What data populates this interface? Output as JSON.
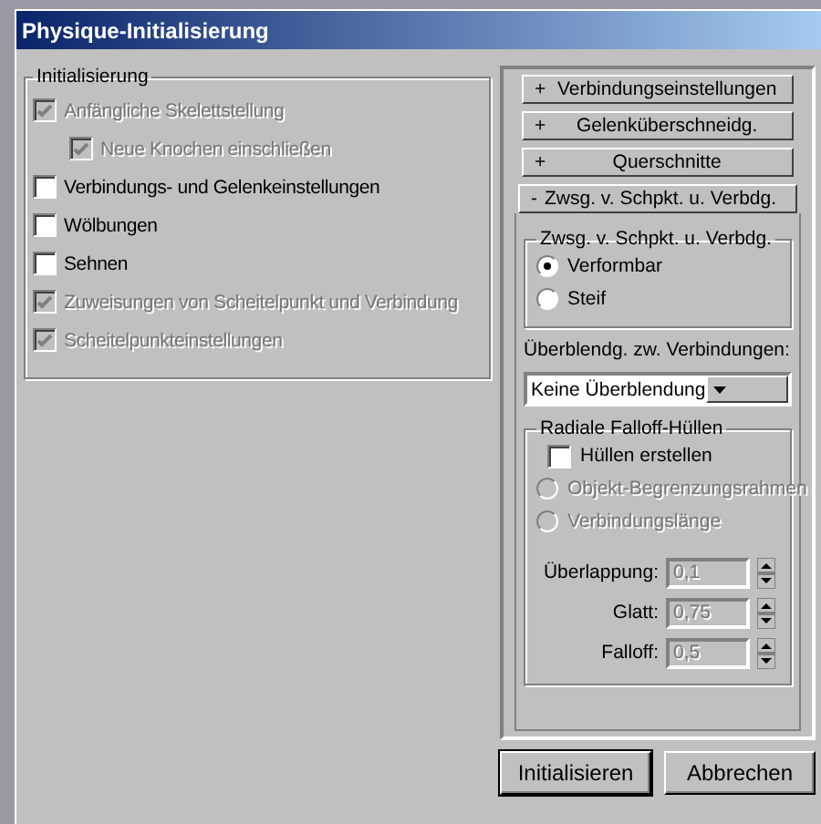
{
  "window": {
    "title": "Physique-Initialisierung"
  },
  "init_group": {
    "title": "Initialisierung",
    "options": [
      {
        "label": "Anfängliche Skelettstellung",
        "checked": true,
        "disabled": true,
        "children": [
          {
            "label": "Neue Knochen einschließen",
            "checked": true,
            "disabled": true
          }
        ]
      },
      {
        "label": "Verbindungs- und Gelenkeinstellungen",
        "checked": false,
        "disabled": false
      },
      {
        "label": "Wölbungen",
        "checked": false,
        "disabled": false
      },
      {
        "label": "Sehnen",
        "checked": false,
        "disabled": false
      },
      {
        "label": "Zuweisungen von Scheitelpunkt und Verbindung",
        "checked": true,
        "disabled": true
      },
      {
        "label": "Scheitelpunkteinstellungen",
        "checked": true,
        "disabled": true
      }
    ]
  },
  "rollouts": [
    {
      "sign": "+",
      "label": "Verbindungseinstellungen",
      "expanded": false
    },
    {
      "sign": "+",
      "label": "Gelenküberschneidg.",
      "expanded": false
    },
    {
      "sign": "+",
      "label": "Querschnitte",
      "expanded": false
    },
    {
      "sign": "-",
      "label": "Zwsg. v. Schpkt. u. Verbdg.",
      "expanded": true
    }
  ],
  "assign_panel": {
    "mode_group": {
      "title": "Zwsg. v. Schpkt. u. Verbdg.",
      "radios": [
        {
          "label": "Verformbar",
          "selected": true,
          "disabled": false
        },
        {
          "label": "Steif",
          "selected": false,
          "disabled": false
        }
      ]
    },
    "blend_label": "Überblendg. zw. Verbindungen:",
    "blend_dropdown": {
      "value": "Keine Überblendung"
    },
    "falloff_group": {
      "title": "Radiale Falloff-Hüllen",
      "checkbox": {
        "label": "Hüllen erstellen",
        "checked": false,
        "disabled": false
      },
      "radios": [
        {
          "label": "Objekt-Begrenzungsrahmen",
          "selected": false,
          "disabled": true
        },
        {
          "label": "Verbindungslänge",
          "selected": false,
          "disabled": true
        }
      ],
      "spinners": [
        {
          "label": "Überlappung:",
          "value": "0,1",
          "disabled": true
        },
        {
          "label": "Glatt:",
          "value": "0,75",
          "disabled": true
        },
        {
          "label": "Falloff:",
          "value": "0,5",
          "disabled": true
        }
      ]
    }
  },
  "buttons": [
    "Initialisieren",
    "Abbrechen"
  ]
}
